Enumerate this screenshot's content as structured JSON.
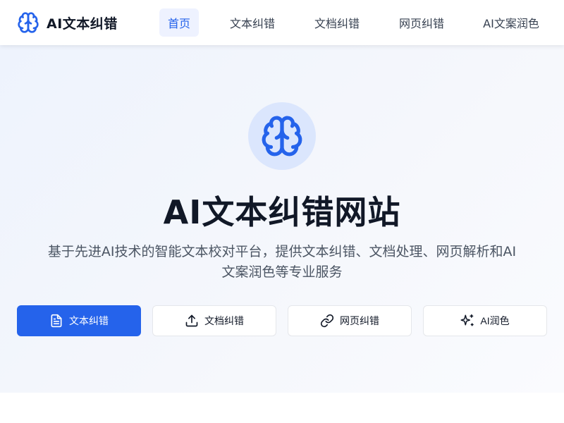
{
  "brand": {
    "name": "AI文本纠错",
    "icon": "brain-icon"
  },
  "nav": {
    "items": [
      {
        "label": "首页",
        "active": true
      },
      {
        "label": "文本纠错",
        "active": false
      },
      {
        "label": "文档纠错",
        "active": false
      },
      {
        "label": "网页纠错",
        "active": false
      },
      {
        "label": "AI文案润色",
        "active": false
      }
    ]
  },
  "hero": {
    "icon": "brain-icon",
    "title": "AI文本纠错网站",
    "subtitle": "基于先进AI技术的智能文本校对平台，提供文本纠错、文档处理、网页解析和AI文案润色等专业服务"
  },
  "actions": [
    {
      "label": "文本纠错",
      "icon": "document-icon",
      "primary": true
    },
    {
      "label": "文档纠错",
      "icon": "upload-icon",
      "primary": false
    },
    {
      "label": "网页纠错",
      "icon": "link-icon",
      "primary": false
    },
    {
      "label": "AI润色",
      "icon": "sparkles-icon",
      "primary": false
    }
  ],
  "colors": {
    "accent": "#2563eb",
    "nav_active_bg": "#eef2ff",
    "hero_icon_bg": "#dbe6fd",
    "text_primary": "#111827",
    "text_secondary": "#4b5563"
  }
}
